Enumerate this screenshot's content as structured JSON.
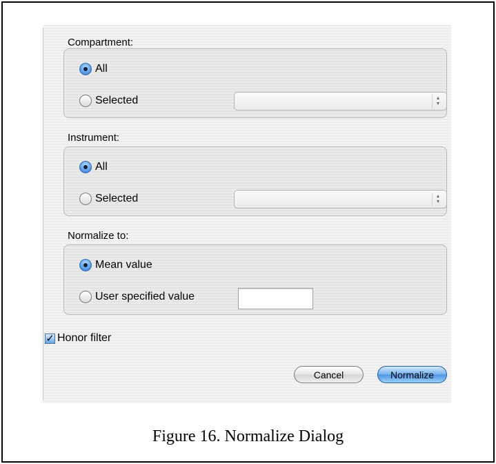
{
  "compartment": {
    "title": "Compartment:",
    "options": [
      {
        "label": "All",
        "selected": true
      },
      {
        "label": "Selected",
        "selected": false
      }
    ],
    "dropdown_value": ""
  },
  "instrument": {
    "title": "Instrument:",
    "options": [
      {
        "label": "All",
        "selected": true
      },
      {
        "label": "Selected",
        "selected": false
      }
    ],
    "dropdown_value": ""
  },
  "normalize": {
    "title": "Normalize to:",
    "options": [
      {
        "label": "Mean value",
        "selected": true
      },
      {
        "label": "User specified value",
        "selected": false
      }
    ],
    "user_value": ""
  },
  "honor_filter": {
    "label": "Honor filter",
    "checked": true
  },
  "buttons": {
    "cancel": "Cancel",
    "normalize": "Normalize"
  },
  "caption": "Figure 16.  Normalize Dialog",
  "colors": {
    "accent": "#5ea2ea"
  }
}
